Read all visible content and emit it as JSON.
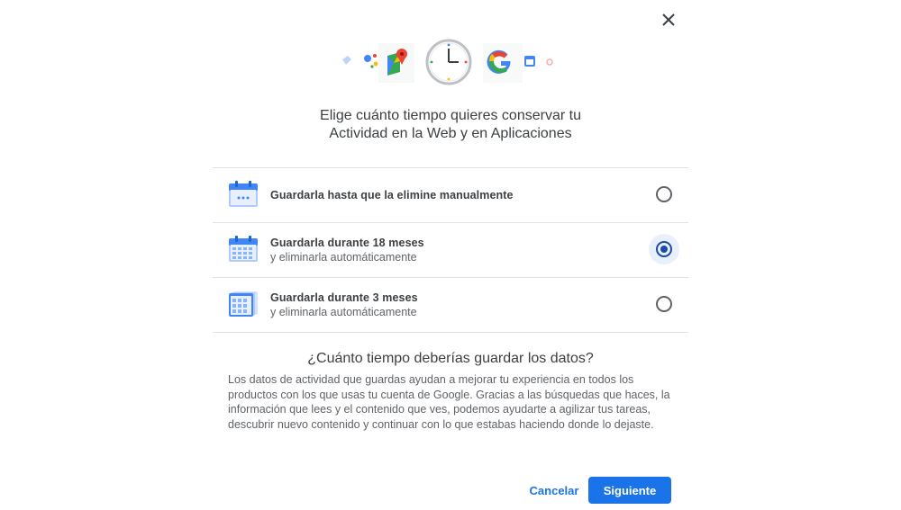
{
  "dialog": {
    "close_icon": "close-icon",
    "title_line1": "Elige cuánto tiempo quieres conservar tu",
    "title_line2": "Actividad en la Web y en Aplicaciones",
    "options": [
      {
        "label": "Guardarla hasta que la elimine manualmente",
        "sublabel": "",
        "icon": "calendar-icon",
        "selected": false
      },
      {
        "label": "Guardarla durante 18 meses",
        "sublabel": "y eliminarla automáticamente",
        "icon": "calendar-18-months-icon",
        "selected": true
      },
      {
        "label": "Guardarla durante 3 meses",
        "sublabel": "y eliminarla automáticamente",
        "icon": "calendar-3-months-icon",
        "selected": false
      }
    ],
    "question": "¿Cuánto tiempo deberías guardar los datos?",
    "description": "Los datos de actividad que guardas ayudan a mejorar tu experiencia en todos los productos con los que usas tu cuenta de Google. Gracias a las búsquedas que haces, la información que lees y el contenido que ves, podemos ayudarte a agilizar tus tareas, descubrir nuevo contenido y continuar con lo que estabas haciendo donde lo dejaste.",
    "cancel_label": "Cancelar",
    "next_label": "Siguiente"
  },
  "colors": {
    "accent": "#1a73e8",
    "radio_selected": "#1a4ba8",
    "radio_selected_bg": "#e8f0fe",
    "divider": "#e3e3e3"
  }
}
